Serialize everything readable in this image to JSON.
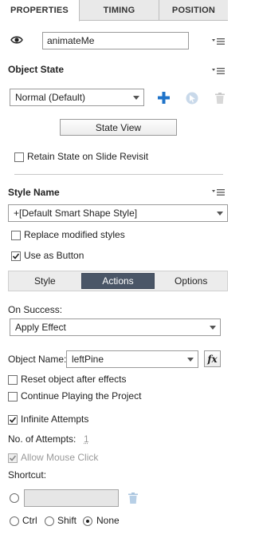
{
  "tabs": [
    {
      "label": "PROPERTIES",
      "active": true
    },
    {
      "label": "TIMING",
      "active": false
    },
    {
      "label": "POSITION",
      "active": false
    }
  ],
  "object": {
    "visibility_icon": "eye-icon",
    "name_value": "animateMe"
  },
  "object_state": {
    "title": "Object State",
    "state_value": "Normal (Default)",
    "state_view_label": "State View",
    "retain_label": "Retain State on Slide Revisit",
    "retain_checked": false
  },
  "style": {
    "title": "Style Name",
    "style_value": "+[Default Smart Shape Style]",
    "replace_label": "Replace modified styles",
    "replace_checked": false,
    "use_as_button_label": "Use as Button",
    "use_as_button_checked": true
  },
  "subtabs": [
    {
      "label": "Style",
      "active": false
    },
    {
      "label": "Actions",
      "active": true
    },
    {
      "label": "Options",
      "active": false
    }
  ],
  "actions": {
    "on_success_label": "On Success:",
    "on_success_value": "Apply Effect",
    "object_name_label": "Object Name:",
    "object_name_value": "leftPine",
    "fx_label": "fx",
    "reset_label": "Reset object after effects",
    "reset_checked": false,
    "continue_label": "Continue Playing the Project",
    "continue_checked": false,
    "infinite_label": "Infinite Attempts",
    "infinite_checked": true,
    "attempts_label": "No. of Attempts:",
    "attempts_value": "1",
    "allow_mouse_label": "Allow Mouse Click",
    "allow_mouse_checked": true,
    "shortcut_label": "Shortcut:",
    "modifiers": [
      {
        "label": "Ctrl",
        "selected": false
      },
      {
        "label": "Shift",
        "selected": false
      },
      {
        "label": "None",
        "selected": true
      }
    ]
  },
  "colors": {
    "accent_blue": "#1f73c9",
    "active_subtab": "#4a5667"
  }
}
